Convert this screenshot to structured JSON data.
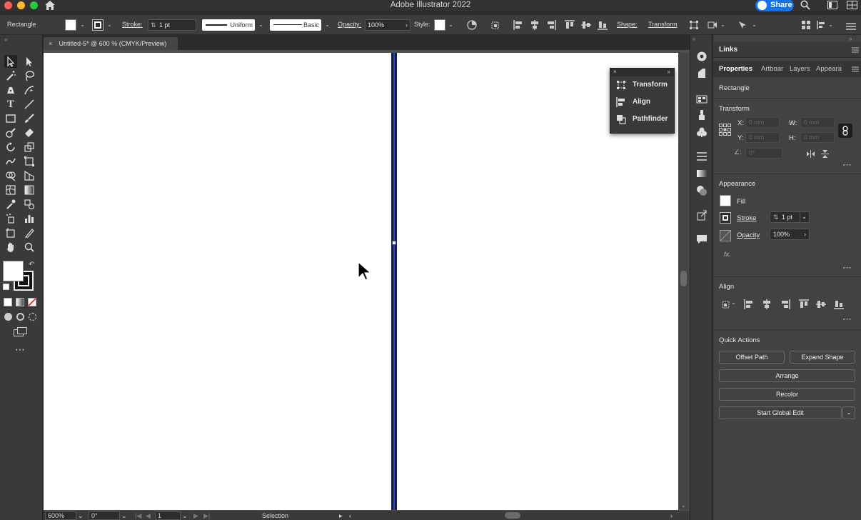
{
  "window": {
    "title": "Adobe Illustrator 2022",
    "share_label": "Share"
  },
  "controlbar": {
    "selection_type": "Rectangle",
    "stroke_label": "Stroke:",
    "stroke_weight": "1 pt",
    "variable_width": "Uniform",
    "brush": "Basic",
    "opacity_label": "Opacity:",
    "opacity_value": "100%",
    "style_label": "Style:",
    "shape_label": "Shape:",
    "transform_label": "Transform"
  },
  "document": {
    "tab_title": "Untitled-5* @ 600 % (CMYK/Preview)"
  },
  "statusbar": {
    "zoom": "600%",
    "rotation": "0°",
    "artboard_number": "1",
    "tool_status": "Selection"
  },
  "float_panel": {
    "items": [
      "Transform",
      "Align",
      "Pathfinder"
    ]
  },
  "panel": {
    "links_tab": "Links",
    "tabs": [
      "Properties",
      "Artboar",
      "Layers",
      "Appeara"
    ],
    "selection": "Rectangle",
    "transform": {
      "heading": "Transform",
      "x_label": "X:",
      "y_label": "Y:",
      "w_label": "W:",
      "h_label": "H:",
      "x_value": "0 mm",
      "y_value": "0 mm",
      "w_value": "0 mm",
      "h_value": "0 mm",
      "angle_value": "0°"
    },
    "appearance": {
      "heading": "Appearance",
      "fill_label": "Fill",
      "stroke_label": "Stroke",
      "stroke_value": "1 pt",
      "opacity_label": "Opacity",
      "opacity_value": "100%",
      "fx_label": "fx."
    },
    "align": {
      "heading": "Align"
    },
    "quick_actions": {
      "heading": "Quick Actions",
      "offset_path": "Offset Path",
      "expand_shape": "Expand Shape",
      "arrange": "Arrange",
      "recolor": "Recolor",
      "start_global_edit": "Start Global Edit"
    }
  },
  "colors": {
    "accent": "#1473e6",
    "selection_blue": "#3048c8",
    "stroke_navy": "#101632"
  }
}
